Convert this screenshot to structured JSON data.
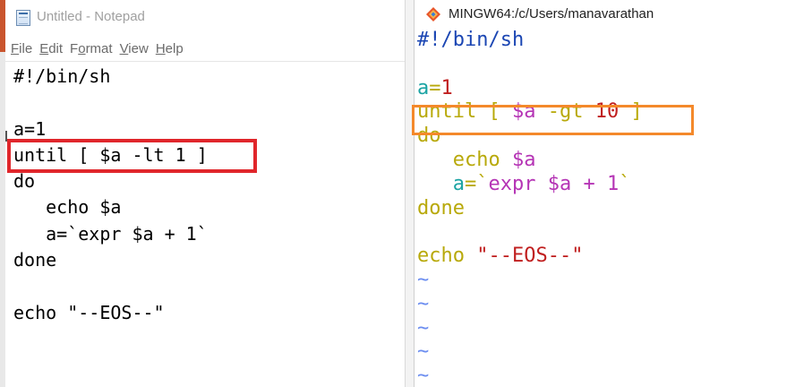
{
  "notepad": {
    "title": "Untitled - Notepad",
    "menu": [
      {
        "key": "F",
        "rest": "ile"
      },
      {
        "key": "E",
        "rest": "dit"
      },
      {
        "key": "",
        "rest": "F",
        "key2": "o",
        "rest2": "rmat"
      },
      {
        "key": "V",
        "rest": "iew"
      },
      {
        "key": "H",
        "rest": "elp"
      }
    ],
    "lines": [
      "#!/bin/sh",
      "",
      "a=1",
      "until [ $a -lt 1 ]",
      "do",
      "   echo $a",
      "   a=`expr $a + 1`",
      "done",
      "",
      "echo \"--EOS--\""
    ],
    "highlight_color": "#e0262b"
  },
  "terminal": {
    "title": "MINGW64:/c/Users/manavarathan",
    "colors": {
      "blue": "#1b46b3",
      "teal": "#1aa3a3",
      "olive": "#b8a90a",
      "magenta": "#b534b5",
      "red": "#c01f1f",
      "tilde": "#6b8df0"
    },
    "lines": [
      [
        {
          "t": "#!/bin/sh",
          "c": "blue"
        }
      ],
      [],
      [
        {
          "t": "a",
          "c": "teal"
        },
        {
          "t": "=",
          "c": "olive"
        },
        {
          "t": "1",
          "c": "red"
        }
      ],
      [
        {
          "t": "until",
          "c": "olive"
        },
        {
          "t": " [ ",
          "c": "olive"
        },
        {
          "t": "$a",
          "c": "magenta"
        },
        {
          "t": " -gt ",
          "c": "olive"
        },
        {
          "t": "10",
          "c": "red"
        },
        {
          "t": " ]",
          "c": "olive"
        }
      ],
      [
        {
          "t": "do",
          "c": "olive"
        }
      ],
      [
        {
          "t": "   echo ",
          "c": "olive"
        },
        {
          "t": "$a",
          "c": "magenta"
        }
      ],
      [
        {
          "t": "   a",
          "c": "teal"
        },
        {
          "t": "=`",
          "c": "olive"
        },
        {
          "t": "expr ",
          "c": "magenta"
        },
        {
          "t": "$a",
          "c": "magenta"
        },
        {
          "t": " + 1",
          "c": "magenta"
        },
        {
          "t": "`",
          "c": "olive"
        }
      ],
      [
        {
          "t": "done",
          "c": "olive"
        }
      ],
      [],
      [
        {
          "t": "echo ",
          "c": "olive"
        },
        {
          "t": "\"--EOS--\"",
          "c": "red"
        }
      ],
      [
        {
          "t": "~",
          "c": "tilde"
        }
      ],
      [
        {
          "t": "~",
          "c": "tilde"
        }
      ],
      [
        {
          "t": "~",
          "c": "tilde"
        }
      ],
      [
        {
          "t": "~",
          "c": "tilde"
        }
      ],
      [
        {
          "t": "~",
          "c": "tilde"
        }
      ]
    ],
    "highlight_color": "#f4892b"
  }
}
